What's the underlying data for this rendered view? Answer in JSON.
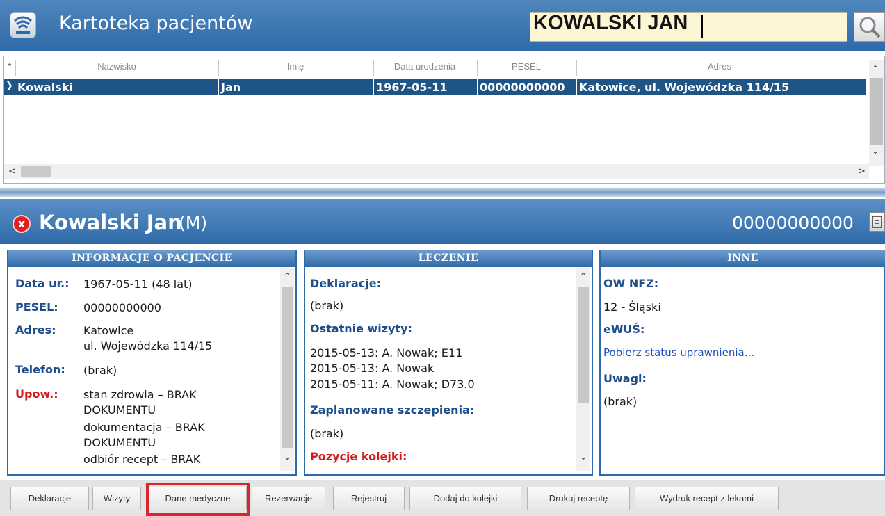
{
  "header": {
    "title": "Kartoteka pacjentów",
    "search_value": "KOWALSKI JAN"
  },
  "grid": {
    "columns": [
      "Nazwisko",
      "Imię",
      "Data urodzenia",
      "PESEL",
      "Adres"
    ],
    "star": "*",
    "rows": [
      {
        "nazwisko": "Kowalski",
        "imie": "Jan",
        "data": "1967-05-11",
        "pesel": "00000000000",
        "adres": "Katowice, ul. Wojewódzka 114/15"
      }
    ]
  },
  "patient": {
    "name": "Kowalski Jan",
    "sex": "(M)",
    "pesel": "00000000000",
    "close_glyph": "x"
  },
  "info": {
    "title": "INFORMACJE O PACJENCIE",
    "born_label": "Data ur.:",
    "born_value": "1967-05-11 (48 lat)",
    "pesel_label": "PESEL:",
    "pesel_value": "00000000000",
    "addr_label": "Adres:",
    "addr_line1": "Katowice",
    "addr_line2": "ul. Wojewódzka 114/15",
    "phone_label": "Telefon:",
    "phone_value": "(brak)",
    "upow_label": "Upow.:",
    "upow_lines": [
      "stan zdrowia – BRAK",
      "DOKUMENTU",
      "dokumentacja – BRAK",
      "DOKUMENTU",
      "odbiór recept – BRAK"
    ]
  },
  "treatment": {
    "title": "LECZENIE",
    "decl_label": "Deklaracje:",
    "decl_value": "(brak)",
    "visits_label": "Ostatnie wizyty:",
    "visits": [
      "2015-05-13: A. Nowak; E11",
      "2015-05-13: A. Nowak",
      "2015-05-11: A. Nowak; D73.0"
    ],
    "vacc_label": "Zaplanowane szczepienia:",
    "vacc_value": "(brak)",
    "queue_label": "Pozycje kolejki:"
  },
  "other": {
    "title": "INNE",
    "nfz_label": "OW NFZ:",
    "nfz_value": "12 - Śląski",
    "ewus_label": "eWUŚ:",
    "ewus_link": "Pobierz status uprawnienia...",
    "notes_label": "Uwagi:",
    "notes_value": "(brak)"
  },
  "toolbar": {
    "buttons": [
      "Deklaracje",
      "Wizyty",
      "Dane medyczne",
      "Rezerwacje",
      "Rejestruj",
      "Dodaj do kolejki",
      "Drukuj receptę",
      "Wydruk recept z lekami"
    ],
    "highlight_color": "#d7262e"
  },
  "icons": {
    "app": "card-index-icon",
    "search": "magnifier-icon",
    "close": "close-icon",
    "spin": "spin-icon"
  }
}
